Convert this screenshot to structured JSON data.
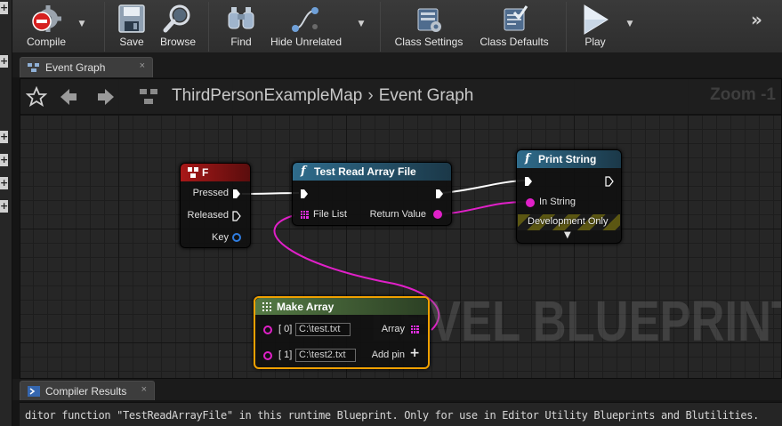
{
  "toolbar": {
    "items": [
      {
        "label": "Compile",
        "icon": "compile-icon"
      },
      {
        "label": "Save",
        "icon": "save-icon"
      },
      {
        "label": "Browse",
        "icon": "browse-icon"
      },
      {
        "label": "Find",
        "icon": "find-icon"
      },
      {
        "label": "Hide Unrelated",
        "icon": "hide-unrelated-icon"
      },
      {
        "label": "Class Settings",
        "icon": "class-settings-icon"
      },
      {
        "label": "Class Defaults",
        "icon": "class-defaults-icon"
      },
      {
        "label": "Play",
        "icon": "play-icon"
      }
    ],
    "more_glyph": "»"
  },
  "tabs": {
    "event_graph": {
      "label": "Event Graph",
      "close": "×"
    },
    "compiler_results": {
      "label": "Compiler Results",
      "close": "×"
    }
  },
  "graph": {
    "breadcrumb": {
      "map": "ThirdPersonExampleMap",
      "separator": "›",
      "current": "Event Graph"
    },
    "zoom": "Zoom -1",
    "watermark": "LEVEL BLUEPRINT"
  },
  "nodes": {
    "f_event": {
      "title": "F",
      "pins": {
        "pressed": "Pressed",
        "released": "Released",
        "key": "Key"
      },
      "header_color": "#8c1414"
    },
    "test_read": {
      "title": "Test Read Array File",
      "pins": {
        "file_list": "File List",
        "return_value": "Return Value"
      },
      "header_color": "#2c5f7a"
    },
    "print_string": {
      "title": "Print String",
      "pins": {
        "in_string": "In String"
      },
      "dev_only": "Development Only",
      "header_color": "#2c5f7a"
    },
    "make_array": {
      "title": "Make Array",
      "pins": {
        "index0": "[ 0]",
        "index1": "[ 1]",
        "array": "Array",
        "add_pin": "Add pin"
      },
      "values": {
        "index0": "C:\\test.txt",
        "index1": "C:\\test2.txt"
      },
      "header_color": "#4a6e3a"
    }
  },
  "console": {
    "line": "ditor function \"TestReadArrayFile\" in this runtime Blueprint. Only for use in Editor Utility Blueprints and Blutilities."
  },
  "colors": {
    "exec": "#ffffff",
    "string_pin": "#e024c8",
    "key_pin": "#2f7de0",
    "selection": "#f0a000"
  }
}
